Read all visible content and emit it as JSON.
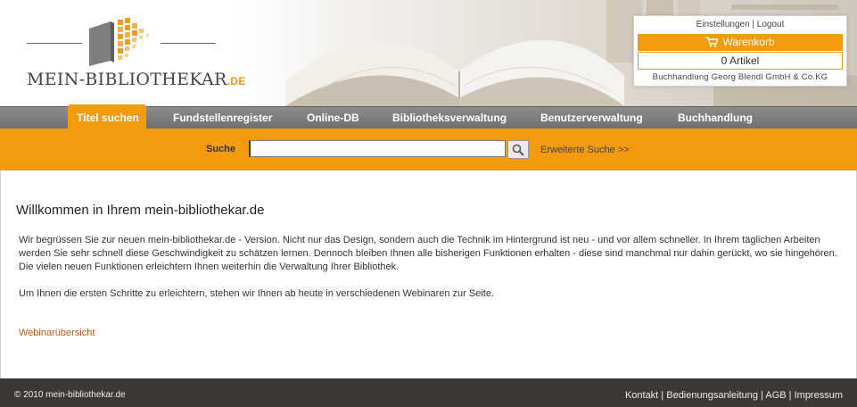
{
  "brand": {
    "logo_main": "MEIN-BIBLIOTHEKAR",
    "logo_tld": ".DE"
  },
  "account": {
    "settings_label": "Einstellungen",
    "separator": " | ",
    "logout_label": "Logout",
    "cart_label": "Warenkorb",
    "cart_count": "0 Artikel",
    "store_name": "Buchhandlung Georg Blendl GmbH & Co.KG"
  },
  "nav": {
    "items": [
      {
        "label": "Titel suchen"
      },
      {
        "label": "Fundstellenregister"
      },
      {
        "label": "Online-DB"
      },
      {
        "label": "Bibliotheksverwaltung"
      },
      {
        "label": "Benutzerverwaltung"
      },
      {
        "label": "Buchhandlung"
      }
    ]
  },
  "search": {
    "label": "Suche",
    "value": "",
    "advanced_link": "Erweiterte Suche >>"
  },
  "main": {
    "title": "Willkommen in Ihrem mein-bibliothekar.de",
    "paragraph1": "Wir begrüssen Sie zur neuen mein-bibliothekar.de - Version. Nicht nur das Design, sondern auch die Technik im Hintergrund ist neu - und vor allem schneller. In Ihrem täglichen Arbeiten werden Sie sehr schnell diese Geschwindigkeit zu schätzen lernen. Dennoch bleiben Ihnen alle bisherigen Funktionen erhalten - diese sind manchmal nur dahin gerückt, wo sie hingehören.",
    "paragraph2": "Die vielen neuen Funktionen erleichtern Ihnen weiterhin die Verwaltung Ihrer Bibliothek.",
    "paragraph3": "Um Ihnen die ersten Schritte zu erleichtern, stehen wir Ihnen ab heute in verschiedenen Webinaren zur Seite.",
    "webinar_link": "Webinarübersicht"
  },
  "footer": {
    "copyright": "© 2010 mein-bibliothekar.de",
    "links": [
      "Kontakt",
      "Bedienungsanleitung",
      "AGB",
      "Impressum"
    ],
    "separator": " | "
  },
  "colors": {
    "accent": "#f49a0f",
    "nav_bg": "#7b7b7b",
    "footer_bg": "#3b3836",
    "link": "#c0581a"
  }
}
